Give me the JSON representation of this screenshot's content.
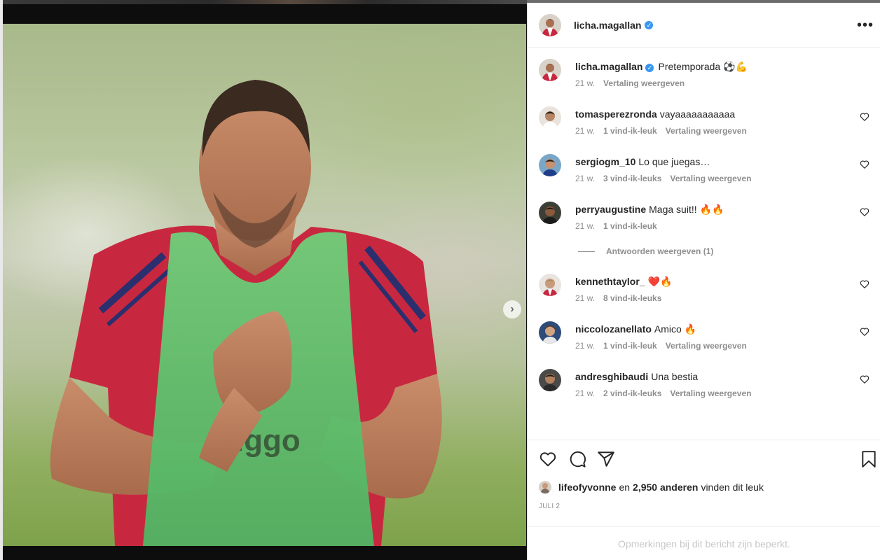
{
  "post": {
    "username": "licha.magallan",
    "verified": true,
    "caption": "Pretemporada ⚽💪",
    "caption_time": "21 w.",
    "caption_translate": "Vertaling weergeven",
    "more_icon": "more-horizontal-icon"
  },
  "media": {
    "carousel_count": 2,
    "active_index": 0,
    "next_icon": "chevron-right-icon",
    "shirt_text": "Ziggo"
  },
  "comments": [
    {
      "username": "tomasperezronda",
      "text": "vayaaaaaaaaaaa",
      "time": "21 w.",
      "likes": "1 vind-ik-leuk",
      "translate": "Vertaling weergeven"
    },
    {
      "username": "sergiogm_10",
      "text": "Lo que juegas…",
      "time": "21 w.",
      "likes": "3 vind-ik-leuks",
      "translate": "Vertaling weergeven"
    },
    {
      "username": "perryaugustine",
      "text": "Maga suit!! 🔥🔥",
      "time": "21 w.",
      "likes": "1 vind-ik-leuk",
      "translate": ""
    },
    {
      "username": "kennethtaylor_",
      "text": "❤️🔥",
      "time": "21 w.",
      "likes": "8 vind-ik-leuks",
      "translate": ""
    },
    {
      "username": "niccolozanellato",
      "text": "Amico 🔥",
      "time": "21 w.",
      "likes": "1 vind-ik-leuk",
      "translate": "Vertaling weergeven"
    },
    {
      "username": "andresghibaudi",
      "text": "Una bestia",
      "time": "21 w.",
      "likes": "2 vind-ik-leuks",
      "translate": "Vertaling weergeven"
    }
  ],
  "replies_label": "Antwoorden weergeven (1)",
  "actions": {
    "icons": [
      "heart-icon",
      "comment-icon",
      "share-icon",
      "bookmark-icon"
    ]
  },
  "likes_summary": {
    "liker": "lifeofyvonne",
    "connector": "en",
    "count": "2,950 anderen",
    "suffix": "vinden dit leuk"
  },
  "date": "JULI 2",
  "footer": "Opmerkingen bij dit bericht zijn beperkt.",
  "colors": {
    "verified": "#3897f0",
    "text_primary": "#262626",
    "text_secondary": "#8e8e8e",
    "border": "#efefef"
  }
}
